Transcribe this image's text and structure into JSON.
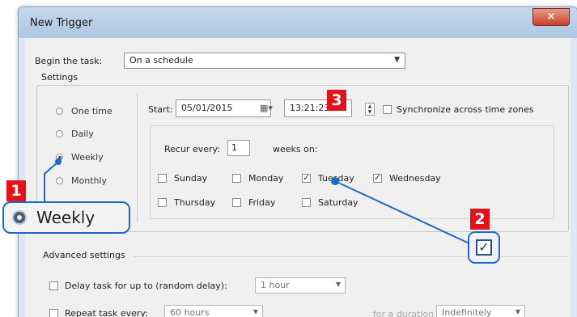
{
  "window": {
    "title": "New Trigger",
    "close_icon": "×"
  },
  "begin_task": {
    "label": "Begin the task:",
    "value": "On a schedule"
  },
  "settings": {
    "label": "Settings",
    "frequencies": [
      {
        "label": "One time",
        "selected": false
      },
      {
        "label": "Daily",
        "selected": false
      },
      {
        "label": "Weekly",
        "selected": true
      },
      {
        "label": "Monthly",
        "selected": false
      }
    ],
    "start_label": "Start:",
    "start_date": "05/01/2015",
    "start_time": "13:21:23",
    "sync_label": "Synchronize across time zones",
    "sync_checked": false,
    "recur_label": "Recur every:",
    "recur_value": "1",
    "weeks_on_label": "weeks on:",
    "days": [
      {
        "label": "Sunday",
        "checked": false
      },
      {
        "label": "Monday",
        "checked": false
      },
      {
        "label": "Tuesday",
        "checked": true
      },
      {
        "label": "Wednesday",
        "checked": true
      },
      {
        "label": "Thursday",
        "checked": false
      },
      {
        "label": "Friday",
        "checked": false
      },
      {
        "label": "Saturday",
        "checked": false
      }
    ]
  },
  "advanced": {
    "label": "Advanced settings",
    "delay_label": "Delay task for up to (random delay):",
    "delay_value": "1 hour",
    "repeat_label": "Repeat task every:",
    "repeat_value": "60 hours",
    "duration_label": "for a duration of:",
    "duration_value": "Indefinitely"
  },
  "callouts": {
    "badge1": "1",
    "badge2": "2",
    "badge3": "3",
    "zoom_weekly_label": "Weekly",
    "zoom_check_mark": "✓",
    "badge_color": "#e3111a",
    "highlight_color": "#1e68c8"
  }
}
